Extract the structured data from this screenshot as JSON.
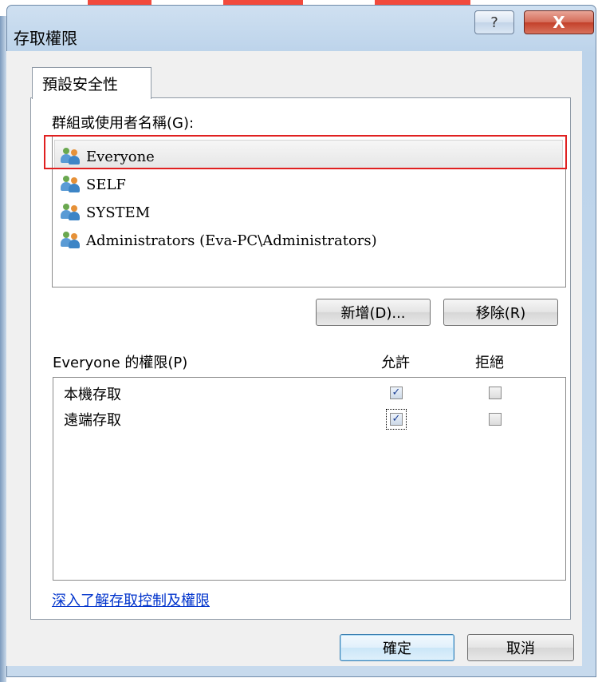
{
  "window": {
    "title": "存取權限"
  },
  "titlebar": {
    "help_symbol": "?",
    "close_symbol": "X"
  },
  "tabs": [
    {
      "label": "預設安全性"
    }
  ],
  "groups": {
    "label": "群組或使用者名稱(G):",
    "items": [
      {
        "name": "Everyone",
        "selected": true
      },
      {
        "name": "SELF"
      },
      {
        "name": "SYSTEM"
      },
      {
        "name": "Administrators (Eva-PC\\Administrators)"
      }
    ],
    "add_button": "新增(D)...",
    "remove_button": "移除(R)"
  },
  "permissions": {
    "label": "Everyone 的權限(P)",
    "allow_header": "允許",
    "deny_header": "拒絕",
    "rows": [
      {
        "name": "本機存取",
        "allow": true,
        "deny": false
      },
      {
        "name": "遠端存取",
        "allow": true,
        "deny": false
      }
    ]
  },
  "link_text": "深入了解存取控制及權限",
  "footer": {
    "ok": "確定",
    "cancel": "取消"
  },
  "icons": {
    "check_glyph": "✓"
  },
  "colors": {
    "link": "#0033cc",
    "highlight_border": "#e02020",
    "close_button": "#c3402a"
  }
}
